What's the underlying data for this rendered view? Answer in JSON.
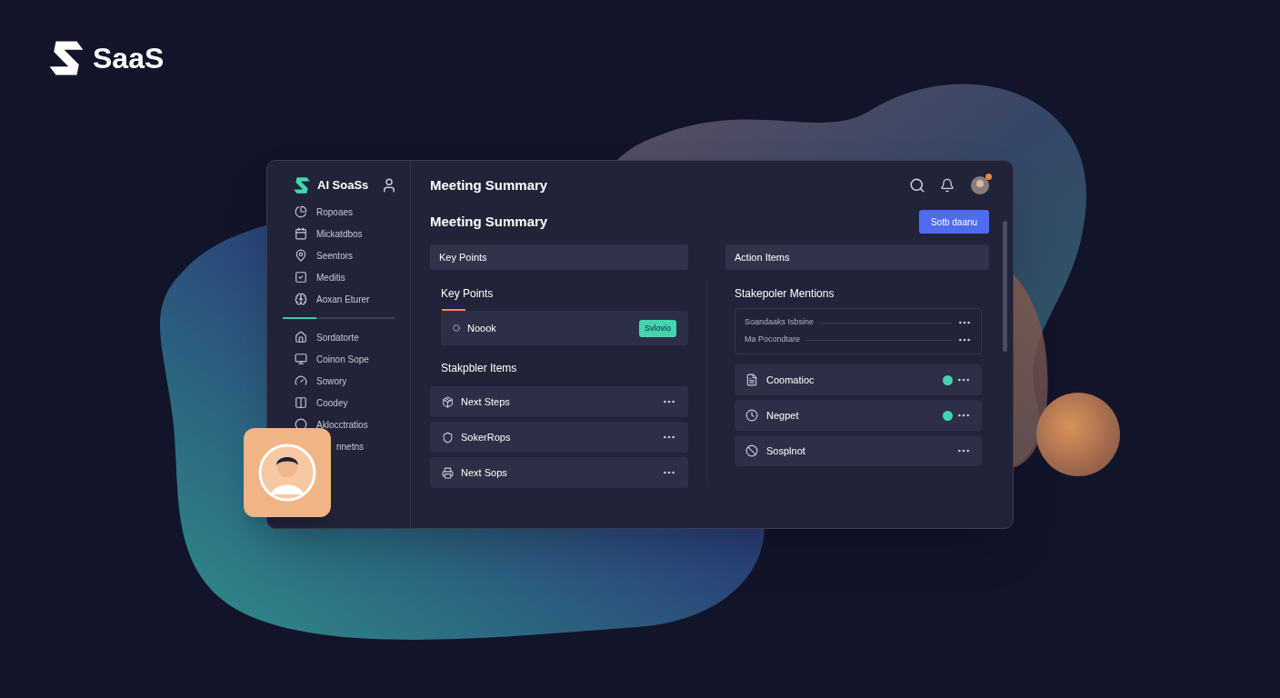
{
  "brand": {
    "name": "SaaS"
  },
  "sidebar": {
    "app_name": "AI SoaSs",
    "items": [
      {
        "label": "Ropoaes"
      },
      {
        "label": "Mickatdbos"
      },
      {
        "label": "Seentors"
      },
      {
        "label": "Meditis"
      },
      {
        "label": "Aoxan Eturer"
      }
    ],
    "divider": {
      "level": 0.3
    },
    "items_lower": [
      {
        "label": "Sordatorte"
      },
      {
        "label": "Coinon Sope"
      },
      {
        "label": "Sowory"
      },
      {
        "label": "Coodey"
      },
      {
        "label": "Aklocctratios"
      },
      {
        "label": "nnetns",
        "kind": "partial"
      }
    ]
  },
  "header": {
    "title": "Meeting Summary",
    "notification": true
  },
  "page": {
    "title": "Meeting Summary",
    "button": "Sotb daanu"
  },
  "left_column": {
    "bar": "Key Points",
    "heading": "Key Points",
    "highlight": {
      "label": "Noook",
      "badge": "Svlovio",
      "selected": false
    },
    "subheading": "Stakpbler Items",
    "rows": [
      {
        "label": "Next Steps"
      },
      {
        "label": "SokerRops"
      },
      {
        "label": "Next Sops"
      }
    ]
  },
  "right_column": {
    "bar": "Action Items",
    "heading": "Stakepoler Mentions",
    "mentions": [
      {
        "label": "Soandaaks Isbsine"
      },
      {
        "label": "Ma Pocondtare"
      }
    ],
    "rows": [
      {
        "label": "Coomatioc",
        "dot": true
      },
      {
        "label": "Negpet",
        "dot": true
      },
      {
        "label": "Sosplnot",
        "dot": false
      }
    ]
  }
}
